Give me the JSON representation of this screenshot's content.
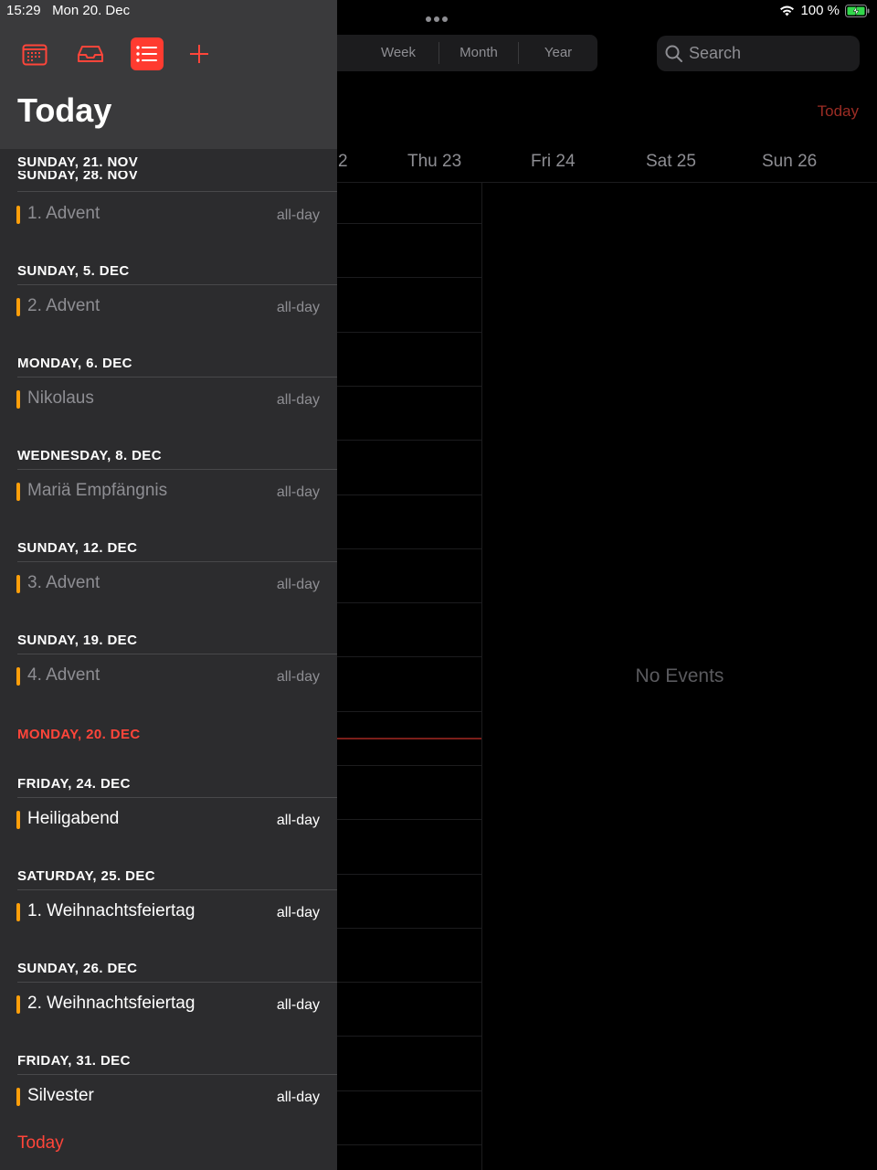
{
  "status_bar": {
    "time": "15:29",
    "date": "Mon 20. Dec",
    "battery": "100 %"
  },
  "background": {
    "view_tabs": [
      "Week",
      "Month",
      "Year"
    ],
    "search_placeholder": "Search",
    "today_button": "Today",
    "day_headers": [
      "2",
      "Thu 23",
      "Fri 24",
      "Sat 25",
      "Sun 26"
    ],
    "no_events": "No Events"
  },
  "panel": {
    "title": "Today",
    "sticky_header": "SUNDAY, 21. NOV",
    "ghost_header": "SUNDAY, 28. NOV",
    "sections": [
      {
        "header": "SUNDAY, 5. DEC",
        "event": "2. Advent",
        "time": "all-day",
        "past": true
      },
      {
        "header": "MONDAY, 6. DEC",
        "event": "Nikolaus",
        "time": "all-day",
        "past": true
      },
      {
        "header": "WEDNESDAY, 8. DEC",
        "event": "Mariä Empfängnis",
        "time": "all-day",
        "past": true
      },
      {
        "header": "SUNDAY, 12. DEC",
        "event": "3. Advent",
        "time": "all-day",
        "past": true
      },
      {
        "header": "SUNDAY, 19. DEC",
        "event": "4. Advent",
        "time": "all-day",
        "past": true
      },
      {
        "header": "MONDAY, 20. DEC",
        "event": "",
        "time": "",
        "past": false,
        "today": true
      },
      {
        "header": "FRIDAY, 24. DEC",
        "event": "Heiligabend",
        "time": "all-day",
        "past": false
      },
      {
        "header": "SATURDAY, 25. DEC",
        "event": "1. Weihnachtsfeiertag",
        "time": "all-day",
        "past": false
      },
      {
        "header": "SUNDAY, 26. DEC",
        "event": "2. Weihnachtsfeiertag",
        "time": "all-day",
        "past": false
      },
      {
        "header": "FRIDAY, 31. DEC",
        "event": "Silvester",
        "time": "all-day",
        "past": false
      }
    ],
    "first_event": {
      "title": "1. Advent",
      "time": "all-day"
    },
    "footer_today": "Today"
  },
  "colors": {
    "accent": "#ff453a",
    "event_bar": "#ff9f0a"
  }
}
